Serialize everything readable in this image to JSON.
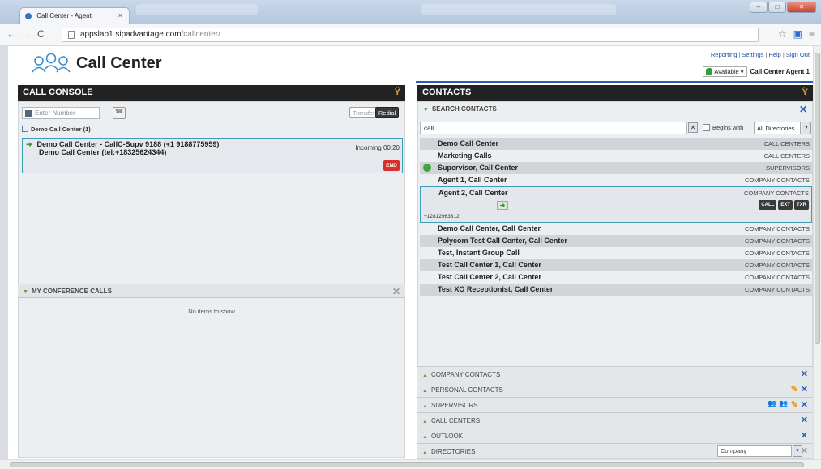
{
  "browser": {
    "tab_title": "Call Center - Agent",
    "tab_close": "×",
    "url_host": "appslab1.sipadvantage.com",
    "url_path": "/callcenter/"
  },
  "header": {
    "app_title": "Call Center",
    "links": [
      "Reporting",
      "Settings",
      "Help",
      "Sign Out"
    ],
    "status": "Available",
    "agent_name": "Call Center Agent 1"
  },
  "console": {
    "title": "CALL CONSOLE",
    "dial_placeholder": "Enter Number",
    "transfer_label": "Transfer",
    "redial_label": "Redial",
    "group_label": "Demo Call Center (1)",
    "call": {
      "line1": "Demo Call Center - CallC-Supv 9188 (+1 9188775959)",
      "line2": "Demo Call Center (tel:+18325624344)",
      "status": "Incoming 00:20",
      "end_label": "END"
    },
    "conference_title": "MY CONFERENCE CALLS",
    "no_items": "No items to show"
  },
  "contacts": {
    "title": "CONTACTS",
    "search_title": "SEARCH CONTACTS",
    "search_value": "call",
    "begins_with_label": "Begins with",
    "directory_filter": "All Directories",
    "results": [
      {
        "name": "Demo Call Center",
        "category": "CALL CENTERS"
      },
      {
        "name": "Marketing Calls",
        "category": "CALL CENTERS"
      },
      {
        "name": "Supervisor, Call Center",
        "category": "SUPERVISORS",
        "available": true
      },
      {
        "name": "Agent 1, Call Center",
        "category": "COMPANY CONTACTS"
      },
      {
        "name": "Agent 2, Call Center",
        "category": "COMPANY CONTACTS",
        "selected": true,
        "number": "+12812963312",
        "actions": [
          "CALL",
          "EXT",
          "TXR"
        ]
      },
      {
        "name": "Demo Call Center, Call Center",
        "category": "COMPANY CONTACTS"
      },
      {
        "name": "Polycom Test Call Center, Call Center",
        "category": "COMPANY CONTACTS"
      },
      {
        "name": "Test, Instant Group Call",
        "category": "COMPANY CONTACTS"
      },
      {
        "name": "Test Call Center 1, Call Center",
        "category": "COMPANY CONTACTS"
      },
      {
        "name": "Test Call Center 2, Call Center",
        "category": "COMPANY CONTACTS"
      },
      {
        "name": "Test XO Receptionist, Call Center",
        "category": "COMPANY CONTACTS"
      }
    ],
    "sections": [
      "COMPANY CONTACTS",
      "PERSONAL CONTACTS",
      "SUPERVISORS",
      "CALL CENTERS",
      "OUTLOOK",
      "DIRECTORIES"
    ],
    "directory_combo": "Company"
  },
  "colors": {
    "header_bg": "#222222",
    "accent_blue": "#2c5ab8",
    "end_red": "#d6302a",
    "available_green": "#3aa83a"
  }
}
